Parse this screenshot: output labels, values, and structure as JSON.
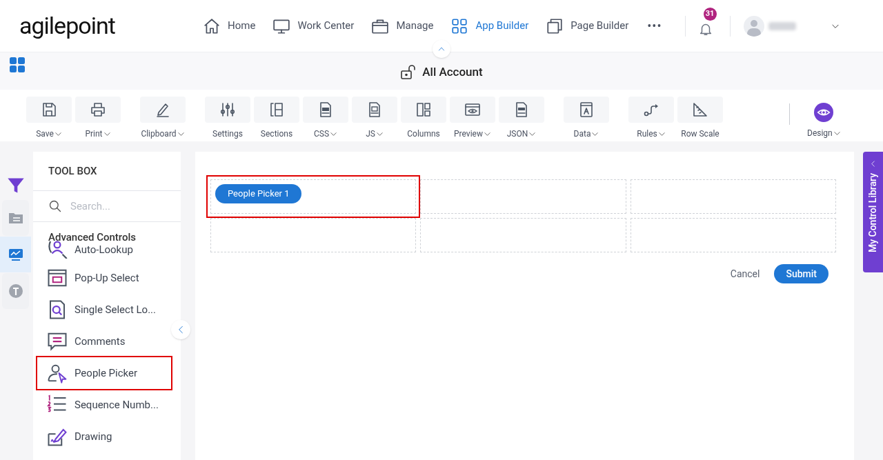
{
  "logo": "agilepoint",
  "nav": [
    {
      "label": "Home",
      "selected": false
    },
    {
      "label": "Work Center",
      "selected": false
    },
    {
      "label": "Manage",
      "selected": false
    },
    {
      "label": "App Builder",
      "selected": true
    },
    {
      "label": "Page Builder",
      "selected": false
    }
  ],
  "more": "•••",
  "notifications": {
    "count": "31"
  },
  "title": "All Account",
  "toolbar": [
    {
      "label": "Save",
      "dropdown": true
    },
    {
      "label": "Print",
      "dropdown": true
    },
    {
      "label": "Clipboard",
      "dropdown": true
    },
    {
      "label": "Settings",
      "dropdown": false
    },
    {
      "label": "Sections",
      "dropdown": false
    },
    {
      "label": "CSS",
      "dropdown": true
    },
    {
      "label": "JS",
      "dropdown": true
    },
    {
      "label": "Columns",
      "dropdown": false
    },
    {
      "label": "Preview",
      "dropdown": true
    },
    {
      "label": "JSON",
      "dropdown": true
    },
    {
      "label": "Data",
      "dropdown": true
    },
    {
      "label": "Rules",
      "dropdown": true
    },
    {
      "label": "Row Scale",
      "dropdown": false
    }
  ],
  "design": {
    "label": "Design",
    "dropdown": true
  },
  "rail": [
    {
      "selected": false
    },
    {
      "selected": false
    },
    {
      "selected": true
    },
    {
      "selected": false
    }
  ],
  "toolbox": {
    "title": "TOOL BOX",
    "search": {
      "placeholder": "Search..."
    },
    "section": "Advanced Controls",
    "items": [
      {
        "label": "Auto-Lookup",
        "highlighted": false
      },
      {
        "label": "Pop-Up Select",
        "highlighted": false
      },
      {
        "label": "Single Select Lo...",
        "highlighted": false
      },
      {
        "label": "Comments",
        "highlighted": false
      },
      {
        "label": "People Picker",
        "highlighted": true
      },
      {
        "label": "Sequence Numb...",
        "highlighted": false
      },
      {
        "label": "Drawing",
        "highlighted": false
      }
    ]
  },
  "canvas": {
    "cells": [
      {
        "control": "People Picker 1",
        "highlighted": true
      },
      {
        "highlighted": false
      },
      {
        "highlighted": false
      },
      {
        "highlighted": false
      },
      {
        "highlighted": false
      },
      {
        "highlighted": false
      }
    ],
    "buttons": [
      {
        "label": "Cancel",
        "kind": "link"
      },
      {
        "label": "Submit",
        "kind": "primary"
      }
    ]
  },
  "library_tab": {
    "label": "My Control Library"
  }
}
